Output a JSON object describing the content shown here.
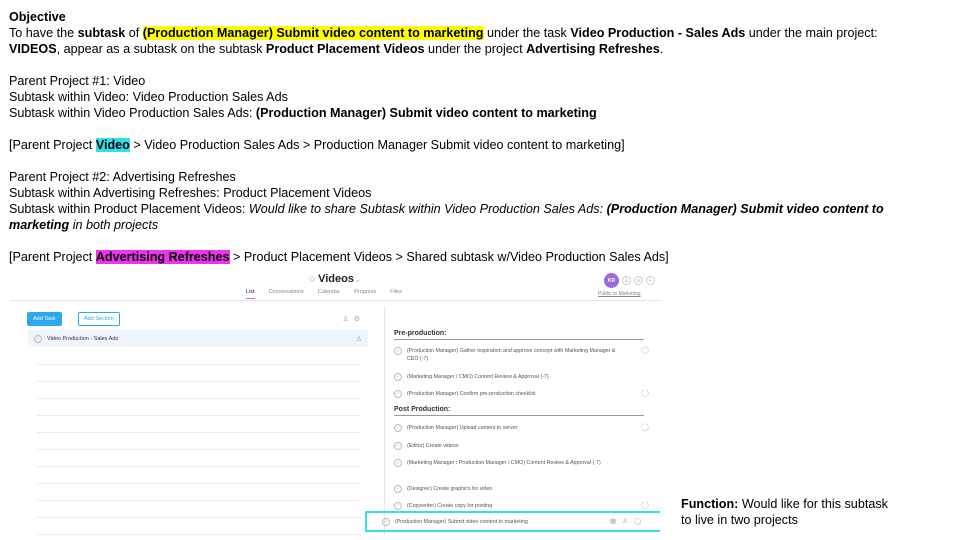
{
  "objective": {
    "heading": "Objective",
    "line1_pre": "To have the ",
    "line1_subtask": "subtask",
    "line1_of": " of ",
    "line1_task_hl": "(Production Manager) Submit video content to marketing",
    "line1_under_task": " under the task ",
    "line1_task_name": "Video Production - Sales Ads",
    "line1_under_main": " under the main project: ",
    "line2_main": "VIDEOS",
    "line2_appear": ", appear as a subtask on the subtask ",
    "line2_ppv": "Product Placement Videos",
    "line2_under_project": " under the project ",
    "line2_project": "Advertising Refreshes",
    "line2_end": "."
  },
  "parent1": {
    "line1": "Parent Project #1: Video",
    "line2": "Subtask within Video: Video Production Sales Ads",
    "line3_pre": "Subtask within Video Production Sales Ads: ",
    "line3_bold": "(Production Manager) Submit video content to marketing",
    "path_pre": "[Parent Project ",
    "path_hl": "Video",
    "path_post": " > Video Production Sales Ads > Production Manager Submit video content to marketing]"
  },
  "parent2": {
    "line1": "Parent Project #2: Advertising Refreshes",
    "line2": "Subtask within Advertising Refreshes: Product Placement Videos",
    "line3_pre": "Subtask within Product Placement Videos: ",
    "line3_italic": "Would like to share Subtask within Video Production Sales Ads: ",
    "line3_bi1": "(Production Manager) Submit video content to",
    "line4_bi": "marketing",
    "line4_italic": " in both projects",
    "path_pre": "[Parent Project ",
    "path_hl": "Advertising Refreshes",
    "path_post": " > Product Placement Videos > Shared subtask w/Video Production Sales Ads]"
  },
  "app": {
    "title": "Videos",
    "tabs": [
      "List",
      "Conversations",
      "Calendar",
      "Progress",
      "Files"
    ],
    "active_tab": "List",
    "avatar_initials": "KR",
    "public_link": "Public to Marketing",
    "add_task_label": "Add Task",
    "add_section_label": "Add Section",
    "selected_task": "Video Production - Sales Ads",
    "sections": [
      {
        "name": "Pre-production:",
        "subtasks": [
          "(Production Manager) Gather inspiration and approve concept with Marketing Manager & CEO (-7)",
          "(Marketing Manager / CMO) Content Review & Approval (-7)",
          "(Production Manager) Confirm pre-production checklist"
        ]
      },
      {
        "name": "Post Production:",
        "subtasks": [
          "(Production Manager) Upload content to server",
          "(Editor) Create videos",
          "(Marketing Manager / Production Manager / CMO) Content Review & Approval (-7)",
          "(Designer) Create graphics for video",
          "(Copywriter) Create copy for posting"
        ]
      }
    ],
    "highlighted_subtask": "(Production Manager) Submit video content to marketing",
    "accent_color": "#33ddee"
  },
  "function_note": {
    "label": "Function:",
    "text": " Would like for this subtask",
    "line2": "to live in two projects"
  }
}
